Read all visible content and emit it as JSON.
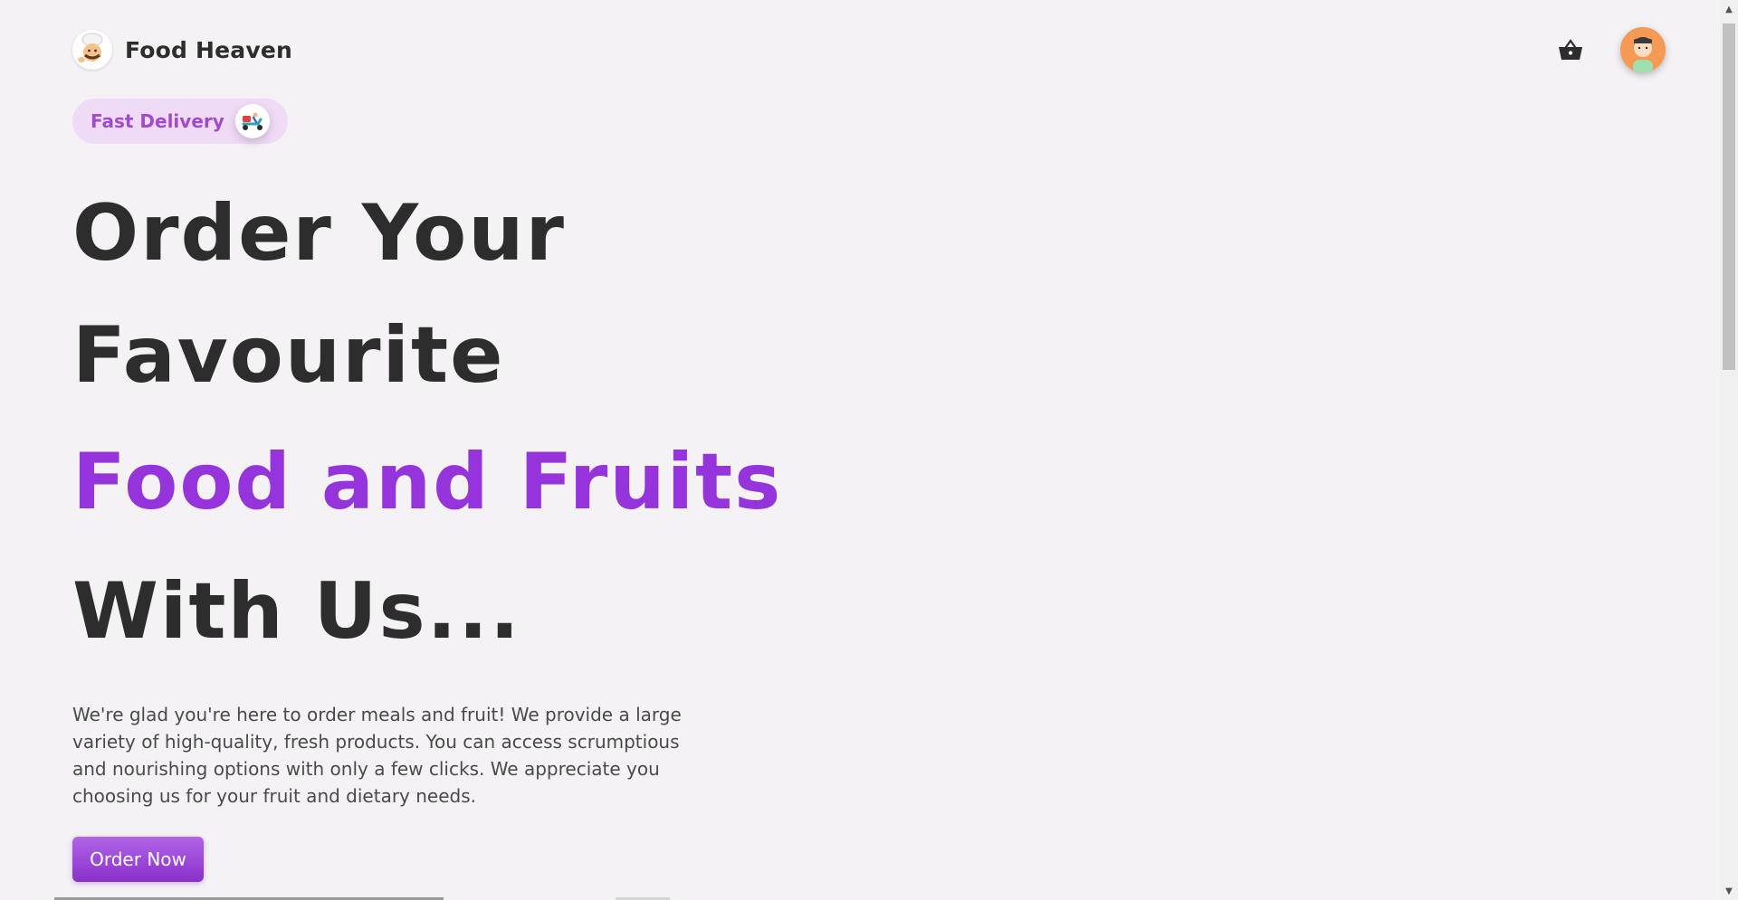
{
  "header": {
    "brand_name": "Food Heaven",
    "logo_icon": "chef-logo-icon",
    "cart_icon": "basket-icon",
    "avatar_icon": "user-avatar-icon"
  },
  "badge": {
    "label": "Fast Delivery",
    "icon": "delivery-scooter-icon"
  },
  "hero": {
    "line1": "Order Your",
    "line2": "Favourite",
    "line3": "Food and Fruits",
    "line4": "With Us..."
  },
  "description": "We're glad you're here to order meals and fruit! We provide a large variety of high-quality, fresh products. You can access scrumptious and nourishing options with only a few clicks. We appreciate you choosing us for your fruit and dietary needs.",
  "cta": {
    "label": "Order Now"
  },
  "colors": {
    "accent": "#9634dc",
    "badge_bg": "#f0dbf6",
    "badge_text": "#a04cc9",
    "background": "#f4f2f4",
    "avatar_bg": "#f49a54"
  }
}
